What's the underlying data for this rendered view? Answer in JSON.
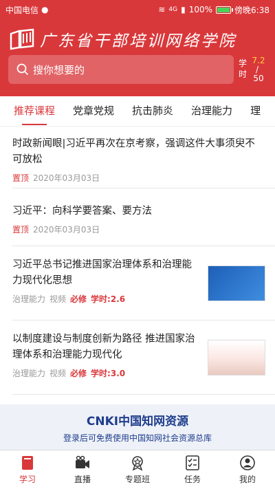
{
  "status_bar": {
    "carrier": "中国电信",
    "network": "4G",
    "battery": "100%",
    "time": "傍晚6:38",
    "battery_level": 1.0
  },
  "header": {
    "title": "广东省干部培训网络学院",
    "search_placeholder": "搜你想要的",
    "credit": {
      "label": "学时",
      "earned": "7.2",
      "slash": "/",
      "required": "50"
    }
  },
  "tabs": [
    "推荐课程",
    "党章党规",
    "抗击肺炎",
    "治理能力",
    "理"
  ],
  "articles": [
    {
      "title": "时政新闻眼|习近平再次在京考察，强调这件大事须臾不可放松",
      "tag": "置顶",
      "date": "2020年03月03日"
    },
    {
      "title": "习近平：向科学要答案、要方法",
      "tag": "置顶",
      "date": "2020年03月03日"
    }
  ],
  "courses": [
    {
      "title": "习近平总书记推进国家治理体系和治理能力现代化思想",
      "category": "治理能力",
      "type": "视频",
      "required": "必修",
      "hours": "学时:2.6"
    },
    {
      "title": "以制度建设与制度创新为路径 推进国家治理体系和治理能力现代化",
      "category": "治理能力",
      "type": "视频",
      "required": "必修",
      "hours": "学时:3.0"
    }
  ],
  "cnki": {
    "title": "CNKI中国知网资源",
    "subtitle": "登录后可免费使用中国知网社会资源总库"
  },
  "bottom_nav": [
    {
      "label": "学习",
      "icon": "book-icon"
    },
    {
      "label": "直播",
      "icon": "video-camera-icon"
    },
    {
      "label": "专题班",
      "icon": "badge-icon"
    },
    {
      "label": "任务",
      "icon": "task-list-icon"
    },
    {
      "label": "我的",
      "icon": "person-icon"
    }
  ],
  "colors": {
    "brand_red": "#d9383b",
    "credit_highlight": "#ffd23b",
    "cnki_blue": "#1f3d8c"
  }
}
